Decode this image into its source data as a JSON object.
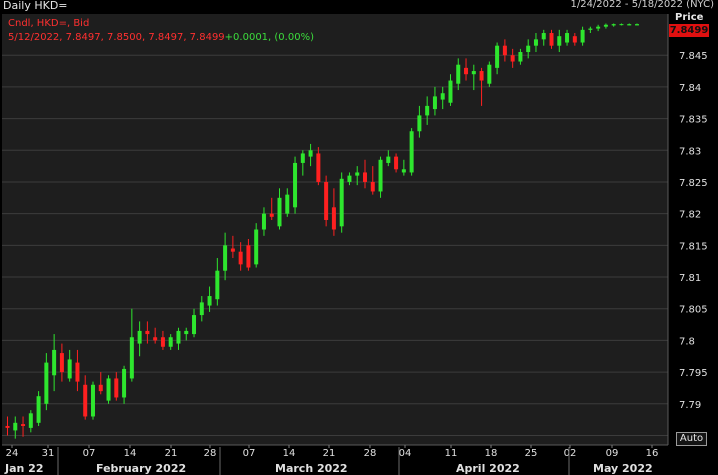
{
  "header": {
    "title": "Daily HKD=",
    "date_range": "1/24/2022 - 5/18/2022 (NYC)",
    "price_label": "Price"
  },
  "legend": {
    "line1": "Cndl, HKD=, Bid",
    "line2_prefix": "5/12/2022, 7.8497, 7.8500, 7.8497, 7.8499",
    "line2_change": "+0.0001, (0.00%)"
  },
  "last_price": "7.8499",
  "auto_label": "Auto",
  "colors": {
    "up": "#2ee62e",
    "down": "#ff2020",
    "background": "#1e1e1e",
    "grid": "#3c3c3c",
    "badge": "#e01010"
  },
  "chart_data": {
    "type": "candlestick",
    "title": "Daily HKD=",
    "ylabel": "Price",
    "ylim": [
      7.7835,
      7.8515
    ],
    "yticks": [
      7.785,
      7.79,
      7.795,
      7.8,
      7.805,
      7.81,
      7.815,
      7.82,
      7.825,
      7.83,
      7.835,
      7.84,
      7.845
    ],
    "x_tick_labels": [
      "24",
      "31",
      "07",
      "14",
      "21",
      "28",
      "07",
      "14",
      "21",
      "28",
      "04",
      "11",
      "18",
      "25",
      "02",
      "09",
      "16"
    ],
    "month_labels": [
      "Jan 22",
      "February 2022",
      "March 2022",
      "April 2022",
      "May 2022"
    ],
    "candles": [
      {
        "date": "1/24",
        "open": 7.7865,
        "high": 7.788,
        "low": 7.785,
        "close": 7.7862
      },
      {
        "date": "1/25",
        "open": 7.7858,
        "high": 7.788,
        "low": 7.7845,
        "close": 7.787
      },
      {
        "date": "1/26",
        "open": 7.7868,
        "high": 7.788,
        "low": 7.7848,
        "close": 7.7865
      },
      {
        "date": "1/27",
        "open": 7.7862,
        "high": 7.789,
        "low": 7.7855,
        "close": 7.7885
      },
      {
        "date": "1/28",
        "open": 7.787,
        "high": 7.792,
        "low": 7.7865,
        "close": 7.7912
      },
      {
        "date": "1/31",
        "open": 7.79,
        "high": 7.798,
        "low": 7.789,
        "close": 7.7965
      },
      {
        "date": "2/01",
        "open": 7.7945,
        "high": 7.801,
        "low": 7.792,
        "close": 7.7985
      },
      {
        "date": "2/02",
        "open": 7.798,
        "high": 7.7995,
        "low": 7.7935,
        "close": 7.795
      },
      {
        "date": "2/03",
        "open": 7.794,
        "high": 7.7985,
        "low": 7.7935,
        "close": 7.797
      },
      {
        "date": "2/04",
        "open": 7.7965,
        "high": 7.7985,
        "low": 7.792,
        "close": 7.7935
      },
      {
        "date": "2/07",
        "open": 7.793,
        "high": 7.7945,
        "low": 7.7875,
        "close": 7.788
      },
      {
        "date": "2/08",
        "open": 7.788,
        "high": 7.7935,
        "low": 7.7875,
        "close": 7.793
      },
      {
        "date": "2/09",
        "open": 7.793,
        "high": 7.795,
        "low": 7.7915,
        "close": 7.792
      },
      {
        "date": "2/10",
        "open": 7.7905,
        "high": 7.7945,
        "low": 7.79,
        "close": 7.794
      },
      {
        "date": "2/11",
        "open": 7.794,
        "high": 7.795,
        "low": 7.7905,
        "close": 7.791
      },
      {
        "date": "2/14",
        "open": 7.791,
        "high": 7.796,
        "low": 7.79,
        "close": 7.7955
      },
      {
        "date": "2/15",
        "open": 7.794,
        "high": 7.805,
        "low": 7.7935,
        "close": 7.8005
      },
      {
        "date": "2/16",
        "open": 7.7995,
        "high": 7.803,
        "low": 7.7975,
        "close": 7.8015
      },
      {
        "date": "2/17",
        "open": 7.8015,
        "high": 7.803,
        "low": 7.7995,
        "close": 7.801
      },
      {
        "date": "2/18",
        "open": 7.8005,
        "high": 7.802,
        "low": 7.7995,
        "close": 7.8
      },
      {
        "date": "2/22",
        "open": 7.8005,
        "high": 7.8015,
        "low": 7.7985,
        "close": 7.799
      },
      {
        "date": "2/23",
        "open": 7.799,
        "high": 7.801,
        "low": 7.7985,
        "close": 7.8005
      },
      {
        "date": "2/24",
        "open": 7.7995,
        "high": 7.802,
        "low": 7.7985,
        "close": 7.8015
      },
      {
        "date": "2/25",
        "open": 7.801,
        "high": 7.802,
        "low": 7.8,
        "close": 7.8015
      },
      {
        "date": "2/28",
        "open": 7.801,
        "high": 7.805,
        "low": 7.8005,
        "close": 7.804
      },
      {
        "date": "3/01",
        "open": 7.804,
        "high": 7.807,
        "low": 7.803,
        "close": 7.806
      },
      {
        "date": "3/02",
        "open": 7.8055,
        "high": 7.8085,
        "low": 7.8045,
        "close": 7.807
      },
      {
        "date": "3/03",
        "open": 7.8065,
        "high": 7.813,
        "low": 7.8055,
        "close": 7.811
      },
      {
        "date": "3/04",
        "open": 7.811,
        "high": 7.817,
        "low": 7.8095,
        "close": 7.815
      },
      {
        "date": "3/07",
        "open": 7.8145,
        "high": 7.8165,
        "low": 7.813,
        "close": 7.814
      },
      {
        "date": "3/08",
        "open": 7.814,
        "high": 7.8155,
        "low": 7.811,
        "close": 7.812
      },
      {
        "date": "3/09",
        "open": 7.815,
        "high": 7.816,
        "low": 7.811,
        "close": 7.8115
      },
      {
        "date": "3/10",
        "open": 7.812,
        "high": 7.8185,
        "low": 7.8115,
        "close": 7.8175
      },
      {
        "date": "3/11",
        "open": 7.8175,
        "high": 7.821,
        "low": 7.8165,
        "close": 7.82
      },
      {
        "date": "3/14",
        "open": 7.82,
        "high": 7.8225,
        "low": 7.819,
        "close": 7.8195
      },
      {
        "date": "3/15",
        "open": 7.818,
        "high": 7.824,
        "low": 7.8175,
        "close": 7.8225
      },
      {
        "date": "3/16",
        "open": 7.82,
        "high": 7.824,
        "low": 7.8195,
        "close": 7.823
      },
      {
        "date": "3/17",
        "open": 7.821,
        "high": 7.829,
        "low": 7.82,
        "close": 7.828
      },
      {
        "date": "3/18",
        "open": 7.828,
        "high": 7.83,
        "low": 7.826,
        "close": 7.8295
      },
      {
        "date": "3/21",
        "open": 7.829,
        "high": 7.831,
        "low": 7.8275,
        "close": 7.83
      },
      {
        "date": "3/22",
        "open": 7.8295,
        "high": 7.8305,
        "low": 7.8245,
        "close": 7.825
      },
      {
        "date": "3/23",
        "open": 7.825,
        "high": 7.826,
        "low": 7.818,
        "close": 7.819
      },
      {
        "date": "3/24",
        "open": 7.821,
        "high": 7.824,
        "low": 7.8165,
        "close": 7.8175
      },
      {
        "date": "3/25",
        "open": 7.818,
        "high": 7.8265,
        "low": 7.817,
        "close": 7.8255
      },
      {
        "date": "3/28",
        "open": 7.825,
        "high": 7.8265,
        "low": 7.8245,
        "close": 7.826
      },
      {
        "date": "3/29",
        "open": 7.826,
        "high": 7.8275,
        "low": 7.8245,
        "close": 7.8265
      },
      {
        "date": "3/30",
        "open": 7.8265,
        "high": 7.8285,
        "low": 7.824,
        "close": 7.825
      },
      {
        "date": "3/31",
        "open": 7.825,
        "high": 7.8275,
        "low": 7.823,
        "close": 7.8235
      },
      {
        "date": "4/01",
        "open": 7.8235,
        "high": 7.829,
        "low": 7.8225,
        "close": 7.8285
      },
      {
        "date": "4/04",
        "open": 7.828,
        "high": 7.83,
        "low": 7.8275,
        "close": 7.829
      },
      {
        "date": "4/05",
        "open": 7.829,
        "high": 7.8295,
        "low": 7.8265,
        "close": 7.827
      },
      {
        "date": "4/06",
        "open": 7.8265,
        "high": 7.8285,
        "low": 7.826,
        "close": 7.827
      },
      {
        "date": "4/07",
        "open": 7.8265,
        "high": 7.8335,
        "low": 7.826,
        "close": 7.833
      },
      {
        "date": "4/08",
        "open": 7.833,
        "high": 7.837,
        "low": 7.832,
        "close": 7.8355
      },
      {
        "date": "4/11",
        "open": 7.8355,
        "high": 7.8385,
        "low": 7.834,
        "close": 7.837
      },
      {
        "date": "4/12",
        "open": 7.8365,
        "high": 7.84,
        "low": 7.8355,
        "close": 7.8385
      },
      {
        "date": "4/13",
        "open": 7.838,
        "high": 7.84,
        "low": 7.8365,
        "close": 7.839
      },
      {
        "date": "4/14",
        "open": 7.8375,
        "high": 7.842,
        "low": 7.837,
        "close": 7.841
      },
      {
        "date": "4/19",
        "open": 7.8405,
        "high": 7.8445,
        "low": 7.8395,
        "close": 7.8435
      },
      {
        "date": "4/20",
        "open": 7.843,
        "high": 7.8445,
        "low": 7.841,
        "close": 7.842
      },
      {
        "date": "4/21",
        "open": 7.842,
        "high": 7.8435,
        "low": 7.8395,
        "close": 7.8425
      },
      {
        "date": "4/22",
        "open": 7.8425,
        "high": 7.843,
        "low": 7.837,
        "close": 7.841
      },
      {
        "date": "4/25",
        "open": 7.8405,
        "high": 7.844,
        "low": 7.84,
        "close": 7.8435
      },
      {
        "date": "4/26",
        "open": 7.843,
        "high": 7.847,
        "low": 7.842,
        "close": 7.8465
      },
      {
        "date": "4/27",
        "open": 7.8465,
        "high": 7.8475,
        "low": 7.844,
        "close": 7.845
      },
      {
        "date": "4/28",
        "open": 7.845,
        "high": 7.846,
        "low": 7.843,
        "close": 7.844
      },
      {
        "date": "4/29",
        "open": 7.844,
        "high": 7.846,
        "low": 7.8435,
        "close": 7.8455
      },
      {
        "date": "5/02",
        "open": 7.8455,
        "high": 7.8475,
        "low": 7.8445,
        "close": 7.8465
      },
      {
        "date": "5/03",
        "open": 7.8465,
        "high": 7.8485,
        "low": 7.8455,
        "close": 7.8475
      },
      {
        "date": "5/04",
        "open": 7.8475,
        "high": 7.849,
        "low": 7.8465,
        "close": 7.8485
      },
      {
        "date": "5/05",
        "open": 7.8485,
        "high": 7.849,
        "low": 7.846,
        "close": 7.8465
      },
      {
        "date": "5/06",
        "open": 7.8465,
        "high": 7.849,
        "low": 7.8455,
        "close": 7.848
      },
      {
        "date": "5/09",
        "open": 7.847,
        "high": 7.849,
        "low": 7.8465,
        "close": 7.8485
      },
      {
        "date": "5/10",
        "open": 7.848,
        "high": 7.8485,
        "low": 7.8465,
        "close": 7.847
      },
      {
        "date": "5/11",
        "open": 7.847,
        "high": 7.8495,
        "low": 7.8465,
        "close": 7.849
      },
      {
        "date": "5/12",
        "open": 7.849,
        "high": 7.8495,
        "low": 7.8485,
        "close": 7.8492
      },
      {
        "date": "5/13",
        "open": 7.8492,
        "high": 7.8498,
        "low": 7.8488,
        "close": 7.8495
      },
      {
        "date": "5/16",
        "open": 7.8495,
        "high": 7.85,
        "low": 7.8492,
        "close": 7.8498
      },
      {
        "date": "5/17",
        "open": 7.8497,
        "high": 7.85,
        "low": 7.8495,
        "close": 7.8499
      },
      {
        "date": "5/18",
        "open": 7.8498,
        "high": 7.85,
        "low": 7.8497,
        "close": 7.8499
      },
      {
        "date": "5/19",
        "open": 7.8497,
        "high": 7.85,
        "low": 7.8497,
        "close": 7.8499
      },
      {
        "date": "5/20",
        "open": 7.8497,
        "high": 7.85,
        "low": 7.8497,
        "close": 7.8499
      }
    ]
  }
}
